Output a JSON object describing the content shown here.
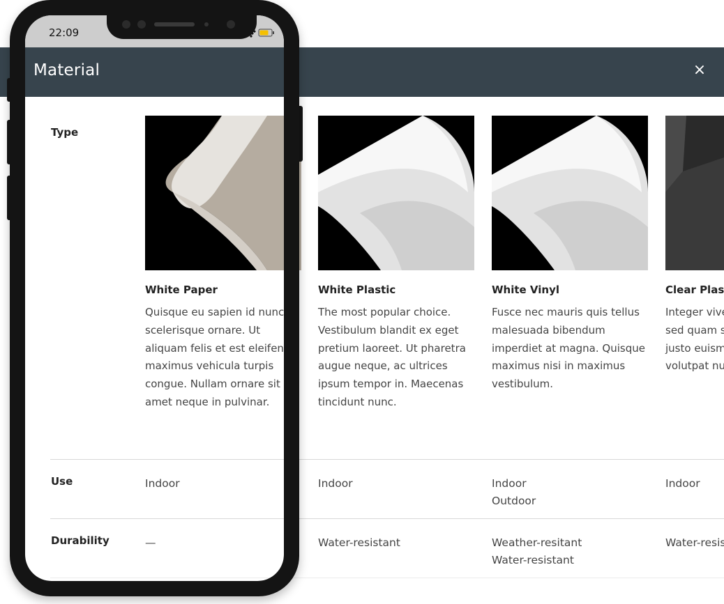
{
  "page": {
    "title": "Material",
    "close_label": "×",
    "row_labels": {
      "type": "Type",
      "use": "Use",
      "durability": "Durability"
    },
    "materials": [
      {
        "name": "White Paper",
        "description": "Quisque eu sapien id nunc scelerisque ornare. Ut aliquam felis et est eleifend, maximus vehicula turpis congue. Nullam ornare sit amet neque in pulvinar.",
        "use": [
          "Indoor"
        ],
        "durability": [
          "—"
        ]
      },
      {
        "name": "White Plastic",
        "description": "The most popular choice. Vestibulum blandit ex eget pretium laoreet. Ut pharetra augue neque, ac ultrices ipsum tempor in. Maecenas tincidunt nunc.",
        "use": [
          "Indoor"
        ],
        "durability": [
          "Water-resistant"
        ]
      },
      {
        "name": "White Vinyl",
        "description": "Fusce nec mauris quis tellus malesuada bibendum imperdiet at magna. Quisque maximus nisi in maximus vestibulum.",
        "use": [
          "Indoor",
          "Outdoor"
        ],
        "durability": [
          "Weather-resitant",
          "Water-resistant"
        ]
      },
      {
        "name": "Clear Plastic",
        "description": "Integer viverra non rutrum sed quam sagittis et efficitur, justo euismod a sapien mollis volutpat nunc.",
        "use": [
          "Indoor"
        ],
        "durability": [
          "Water-resistant"
        ]
      }
    ]
  },
  "phone": {
    "time": "22:09"
  },
  "colors": {
    "header_bg": "#37444d",
    "phone_frame": "#141414",
    "status_bar": "#cdcdcd",
    "battery": "#f5c000"
  }
}
